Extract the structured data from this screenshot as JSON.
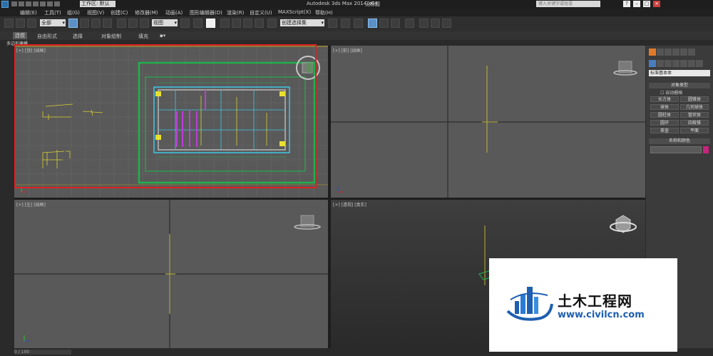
{
  "titlebar": {
    "workspace": "工作区: 默认",
    "title": "Autodesk 3ds Max  2014 x64",
    "document": "无标题",
    "search_placeholder": "键入关键字或短语"
  },
  "menu": [
    "编辑(E)",
    "工具(T)",
    "组(G)",
    "视图(V)",
    "创建(C)",
    "修改器(M)",
    "动画(A)",
    "图形编辑器(D)",
    "渲染(R)",
    "自定义(U)",
    "MAXScript(X)",
    "帮助(H)"
  ],
  "toolbar": {
    "selection_filter": "全部",
    "reference_coord": "视图",
    "named_selection": "创建选择集"
  },
  "ribbon": {
    "tabs": [
      "建模",
      "自由形式",
      "选择",
      "对象绘制",
      "填充"
    ],
    "sub_label": "多边形建模"
  },
  "viewports": {
    "top": "[+] [顶] [线框]",
    "front": "[+] [前] [线框]",
    "left": "[+] [左] [线框]",
    "perspective": "[+] [透视] [真实]"
  },
  "command_panel": {
    "category": "标准基本体",
    "object_type_header": "对象类型",
    "autogrid": "自动栅格",
    "objects": [
      "长方体",
      "圆锥体",
      "球体",
      "几何球体",
      "圆柱体",
      "管状体",
      "圆环",
      "四棱锥",
      "茶壶",
      "平面"
    ],
    "name_color_header": "名称和颜色",
    "swatch_color": "#c7257c"
  },
  "status": {
    "frame": "0 / 100"
  },
  "watermark": {
    "title": "土木工程网",
    "url": "www.civilcn.com"
  },
  "colors": {
    "selection_rect": "#e02020",
    "plan_green": "#22b14c",
    "plan_cyan": "#3cc8e6",
    "plan_magenta": "#c03cd8"
  }
}
